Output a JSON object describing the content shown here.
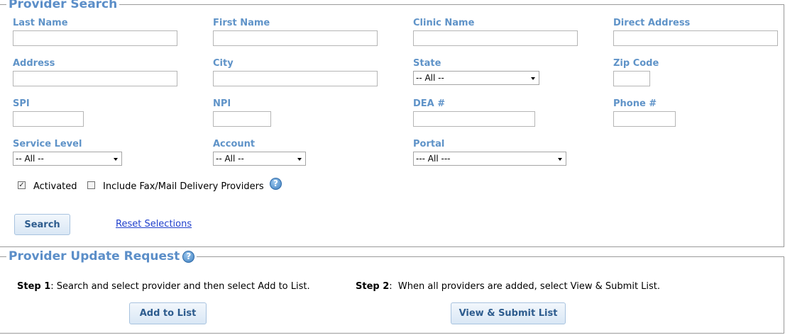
{
  "provider_search": {
    "title": "Provider Search",
    "fields": {
      "last_name": {
        "label": "Last Name",
        "value": ""
      },
      "first_name": {
        "label": "First Name",
        "value": ""
      },
      "clinic_name": {
        "label": "Clinic Name",
        "value": ""
      },
      "direct_address": {
        "label": "Direct Address",
        "value": ""
      },
      "address": {
        "label": "Address",
        "value": ""
      },
      "city": {
        "label": "City",
        "value": ""
      },
      "state": {
        "label": "State",
        "selected": "-- All --"
      },
      "zip_code": {
        "label": "Zip Code",
        "value": ""
      },
      "spi": {
        "label": "SPI",
        "value": ""
      },
      "npi": {
        "label": "NPI",
        "value": ""
      },
      "dea": {
        "label": "DEA #",
        "value": ""
      },
      "phone": {
        "label": "Phone #",
        "value": ""
      },
      "service_level": {
        "label": "Service Level",
        "selected": "-- All --"
      },
      "account": {
        "label": "Account",
        "selected": "-- All --"
      },
      "portal": {
        "label": "Portal",
        "selected": "--- All ---"
      }
    },
    "activated": {
      "label": "Activated",
      "checked": true
    },
    "include_fax": {
      "label": "Include Fax/Mail Delivery Providers",
      "checked": false
    },
    "search_button": "Search",
    "reset_link": "Reset Selections"
  },
  "update_request": {
    "title": "Provider Update Request",
    "step1": {
      "bold": "Step 1",
      "text": ": Search and select provider and then select Add to List."
    },
    "step2": {
      "bold": "Step 2",
      "text": ":  When all providers are added, select View & Submit List."
    },
    "add_button": "Add to List",
    "view_submit_button": "View & Submit List"
  },
  "icons": {
    "help": "help-icon"
  },
  "colors": {
    "label": "#5f93c8",
    "legend": "#5b8ec8",
    "link": "#1f3fcc",
    "button_text": "#2d5c8e"
  }
}
